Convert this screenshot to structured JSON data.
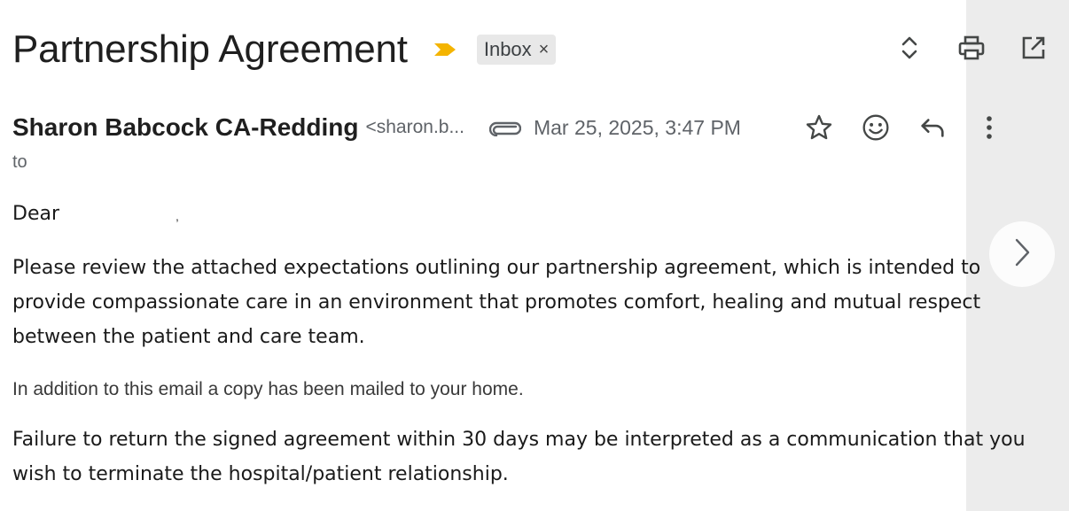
{
  "email": {
    "subject": "Partnership Agreement",
    "label_chip": "Inbox",
    "label_chip_close": "×",
    "sender_name": "Sharon Babcock CA-Redding",
    "sender_email": "<sharon.b...",
    "date": "Mar 25, 2025, 3:47 PM",
    "to_label": "to",
    "greeting": "Dear",
    "greeting_comma": ",",
    "paragraphs": [
      "Please review the attached expectations outlining our partnership agreement, which is intended to provide compassionate care in an environment that promotes comfort, healing and mutual respect between the patient and care team.",
      "In addition to this email a copy has been mailed to your home.",
      "Failure to return the signed agreement within 30 days may be interpreted as a communication that you wish to terminate the hospital/patient relationship."
    ]
  },
  "icons": {
    "importance": "importance-marker-icon",
    "expand": "expand-collapse-icon",
    "print": "print-icon",
    "open_new_window": "open-in-new-window-icon",
    "attachment": "attachment-icon",
    "star": "star-icon",
    "emoji": "emoji-reaction-icon",
    "reply": "reply-icon",
    "more": "more-vertical-icon",
    "next": "chevron-right-icon"
  },
  "colors": {
    "importance": "#f4b400",
    "icon": "#444746",
    "chip_bg": "#e8e8e8",
    "side_panel": "#ececec"
  }
}
